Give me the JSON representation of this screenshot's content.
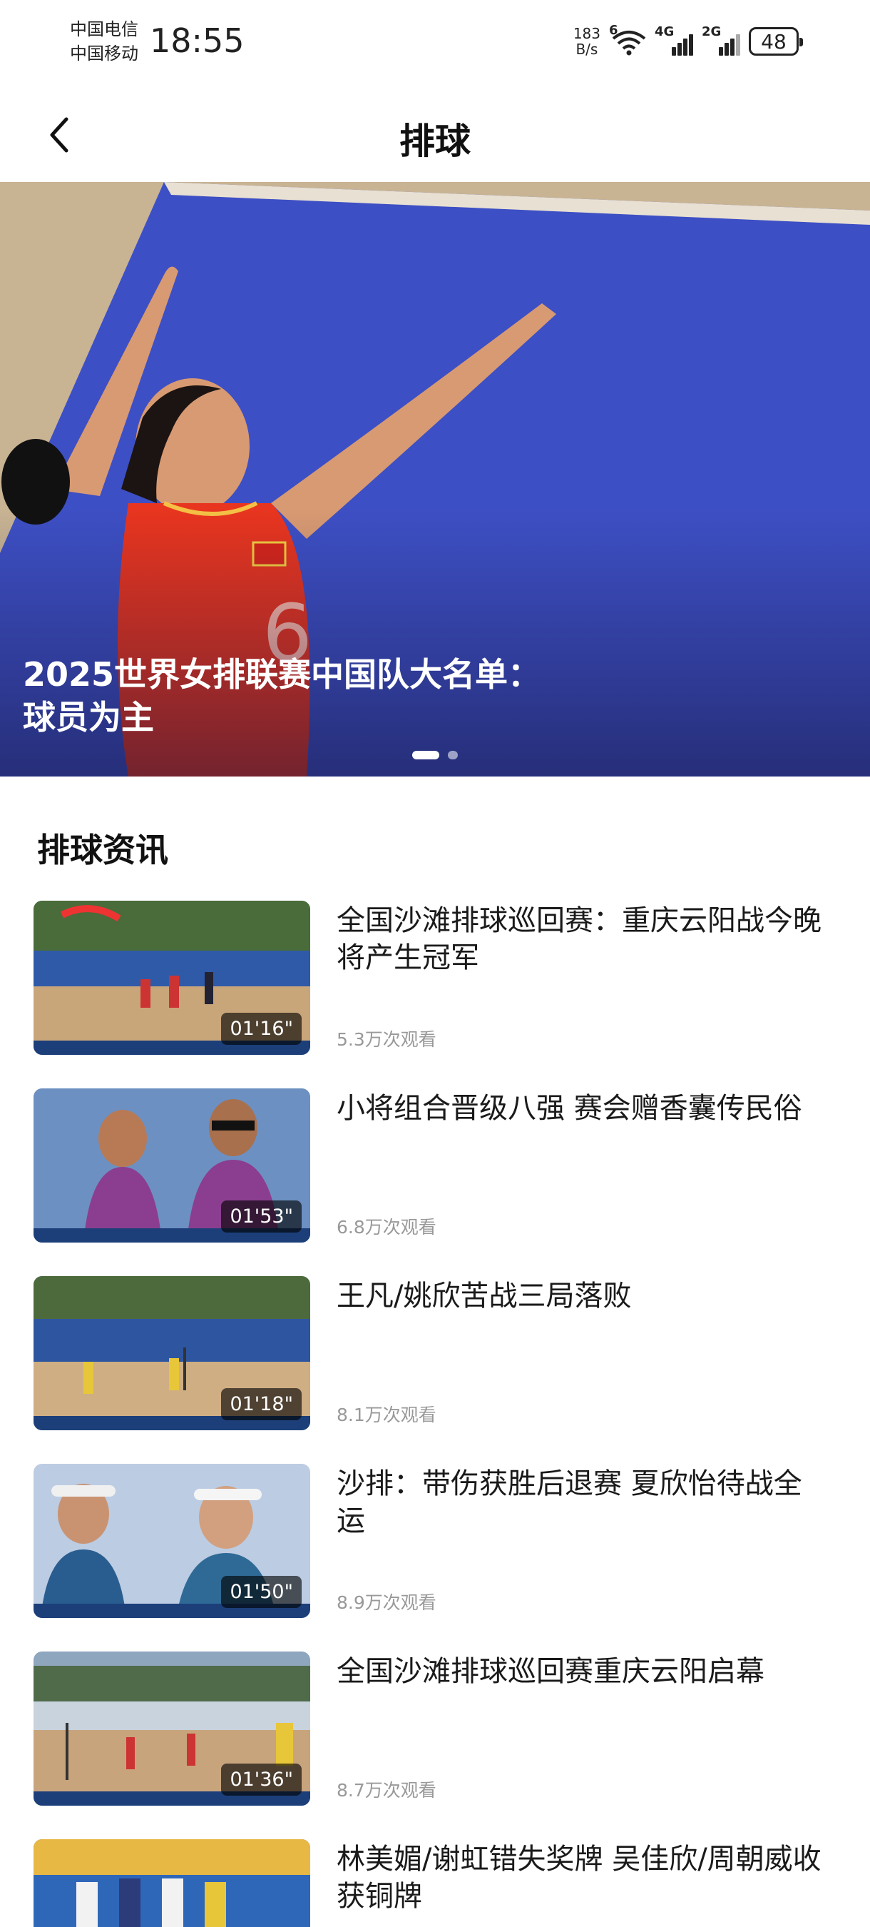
{
  "status_bar": {
    "carrier_1": "中国电信",
    "carrier_2": "中国移动",
    "time": "18:55",
    "net_speed_value": "183",
    "net_speed_unit": "B/s",
    "wifi_label": "6",
    "signal_1_label": "4G",
    "signal_2_label": "2G",
    "battery": "48"
  },
  "header": {
    "title": "排球",
    "back_icon": "chevron-left-icon"
  },
  "banner": {
    "title": "2025世界女排联赛中国队大名单：                    ：球员为主",
    "title_line1": "2025世界女排联赛中国队大名单：",
    "title_line2": "球员为主",
    "slides": 2,
    "active_slide": 1
  },
  "section": {
    "title": "排球资讯"
  },
  "news": [
    {
      "title": "全国沙滩排球巡回赛：重庆云阳战今晚将产生冠军",
      "duration": "01'16\"",
      "views": "5.3万次观看"
    },
    {
      "title": "小将组合晋级八强 赛会赠香囊传民俗",
      "duration": "01'53\"",
      "views": "6.8万次观看"
    },
    {
      "title": "王凡/姚欣苦战三局落败",
      "duration": "01'18\"",
      "views": "8.1万次观看"
    },
    {
      "title": "沙排：带伤获胜后退赛 夏欣怡待战全运",
      "duration": "01'50\"",
      "views": "8.9万次观看"
    },
    {
      "title": "全国沙滩排球巡回赛重庆云阳启幕",
      "duration": "01'36\"",
      "views": "8.7万次观看"
    },
    {
      "title": "林美媚/谢虹错失奖牌 吴佳欣/周朝威收获铜牌",
      "duration": "",
      "views": ""
    }
  ],
  "colors": {
    "court_blue": "#3d4fc4",
    "jersey_red": "#e8351f",
    "sand": "#c9a57a",
    "text_primary": "#1a1a1a",
    "text_secondary": "#999999"
  }
}
